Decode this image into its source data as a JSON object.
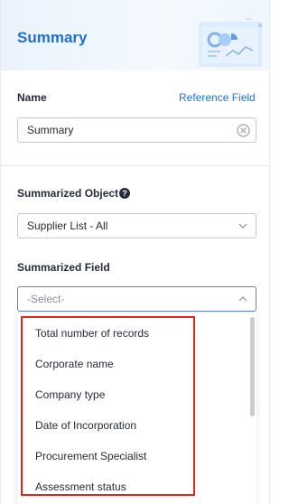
{
  "header": {
    "title": "Summary"
  },
  "name_section": {
    "label": "Name",
    "reference_link": "Reference Field",
    "value": "Summary"
  },
  "summarized_object": {
    "label": "Summarized Object",
    "help": "?",
    "value": "Supplier List - All"
  },
  "summarized_field": {
    "label": "Summarized Field",
    "placeholder": "-Select-"
  },
  "dropdown": {
    "options": [
      "Total number of records",
      "Corporate name",
      "Company type",
      "Date of Incorporation",
      "Procurement Specialist",
      "Assessment status"
    ]
  },
  "colors": {
    "accent": "#1e6fd4",
    "highlight": "#e1251b"
  }
}
